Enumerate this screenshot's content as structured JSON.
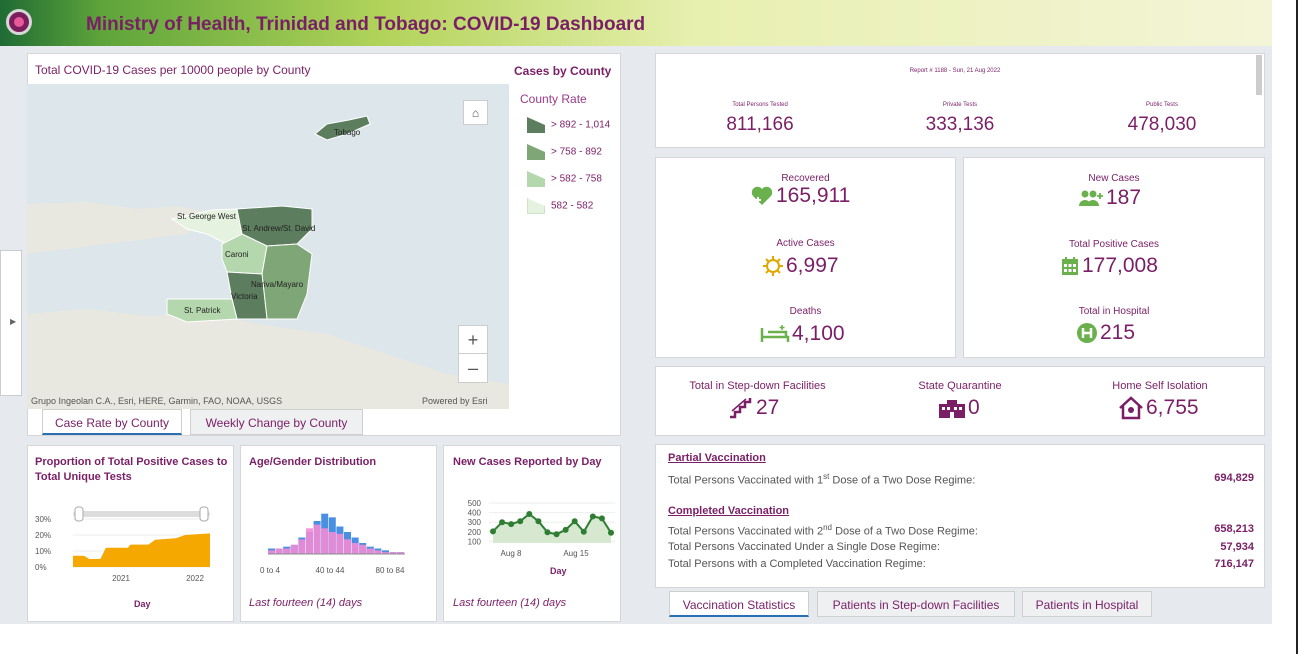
{
  "header": {
    "title": "Ministry of Health, Trinidad and Tobago: COVID-19 Dashboard"
  },
  "map": {
    "title": "Total COVID-19 Cases per 10000 people by County",
    "attribution": "Grupo Ingeolan C.A., Esri, HERE, Garmin, FAO, NOAA, USGS",
    "powered_by": "Powered by Esri",
    "home_icon": "home-icon",
    "zoom_in": "+",
    "zoom_out": "–",
    "counties": [
      "Tobago",
      "St. George West",
      "St. Andrew/St. David",
      "Caroni",
      "Nariva/Mayaro",
      "Victoria",
      "St. Patrick"
    ],
    "legend": {
      "title": "Cases by County",
      "subtitle": "County Rate",
      "items": [
        {
          "label": "> 892 - 1,014",
          "color": "#5c7d5e"
        },
        {
          "label": "> 758 - 892",
          "color": "#7fa677"
        },
        {
          "label": "> 582 - 758",
          "color": "#b5d7ad"
        },
        {
          "label": "582 - 582",
          "color": "#e6f2e0"
        }
      ]
    },
    "tabs": [
      "Case Rate by County",
      "Weekly Change by County"
    ]
  },
  "report": {
    "number": "Report # 1188 - Sun, 21 Aug 2022",
    "tests": [
      {
        "label": "Total Persons Tested",
        "value": "811,166"
      },
      {
        "label": "Private Tests",
        "value": "333,136"
      },
      {
        "label": "Public Tests",
        "value": "478,030"
      }
    ]
  },
  "kpis_left": [
    {
      "label": "Recovered",
      "value": "165,911",
      "icon": "heart-plus-icon",
      "color": "#6ab04c"
    },
    {
      "label": "Active Cases",
      "value": "6,997",
      "icon": "virus-icon",
      "color": "#e0a800"
    },
    {
      "label": "Deaths",
      "value": "4,100",
      "icon": "bed-icon",
      "color": "#6ab04c"
    }
  ],
  "kpis_right": [
    {
      "label": "New Cases",
      "value": "187",
      "icon": "people-plus-icon",
      "color": "#6ab04c"
    },
    {
      "label": "Total Positive Cases",
      "value": "177,008",
      "icon": "calendar-icon",
      "color": "#6ab04c"
    },
    {
      "label": "Total in Hospital",
      "value": "215",
      "icon": "hospital-icon",
      "color": "#6ab04c"
    }
  ],
  "facilities": [
    {
      "label": "Total in Step-down Facilities",
      "value": "27",
      "icon": "stairs-icon"
    },
    {
      "label": "State Quarantine",
      "value": "0",
      "icon": "building-icon"
    },
    {
      "label": "Home Self Isolation",
      "value": "6,755",
      "icon": "house-icon"
    }
  ],
  "vaccination": {
    "partial_heading": "Partial Vaccination",
    "partial_rows": [
      {
        "pre": "Total Persons Vaccinated with 1",
        "sup": "st",
        "post": " Dose of a Two Dose Regime:",
        "value": "694,829"
      }
    ],
    "completed_heading": "Completed Vaccination",
    "completed_rows": [
      {
        "pre": "Total Persons Vaccinated with 2",
        "sup": "nd",
        "post": " Dose of a Two Dose Regime:",
        "value": "658,213"
      },
      {
        "pre": "Total Persons Vaccinated Under a Single Dose Regime:",
        "sup": "",
        "post": "",
        "value": "57,934"
      },
      {
        "pre": "Total Persons with a Completed Vaccination Regime:",
        "sup": "",
        "post": "",
        "value": "716,147"
      }
    ],
    "tabs": [
      "Vaccination Statistics",
      "Patients in Step-down Facilities",
      "Patients in Hospital"
    ]
  },
  "cards": {
    "proportion": {
      "title": "Proportion of Total Positive Cases to Total Unique Tests",
      "xtitle": "Day"
    },
    "age": {
      "title": "Age/Gender Distribution",
      "note": "Last fourteen (14) days"
    },
    "newcases": {
      "title": "New Cases Reported by Day",
      "xtitle": "Day",
      "note": "Last fourteen (14) days"
    }
  },
  "chart_data": [
    {
      "type": "area",
      "title": "Proportion of Total Positive Cases to Total Unique Tests",
      "xlabel": "Day",
      "ylabel": "",
      "x_tick_labels": [
        "2021",
        "2022"
      ],
      "y_tick_labels": [
        "30%",
        "20%",
        "10%",
        "0%"
      ],
      "ylim": [
        0,
        0.3
      ],
      "color": "#f5a800",
      "points": [
        [
          0,
          0.07
        ],
        [
          0.08,
          0.07
        ],
        [
          0.12,
          0.05
        ],
        [
          0.2,
          0.05
        ],
        [
          0.24,
          0.12
        ],
        [
          0.4,
          0.12
        ],
        [
          0.42,
          0.14
        ],
        [
          0.55,
          0.14
        ],
        [
          0.6,
          0.17
        ],
        [
          0.75,
          0.18
        ],
        [
          0.82,
          0.2
        ],
        [
          1,
          0.21
        ]
      ]
    },
    {
      "type": "bar",
      "title": "Age/Gender Distribution",
      "x_tick_labels": [
        "0 to 4",
        "40 to 44",
        "80 to 84"
      ],
      "series": [
        {
          "name": "",
          "color": "#4a90e2",
          "values": [
            3,
            3,
            4,
            5,
            9,
            12,
            18,
            22,
            20,
            15,
            12,
            9,
            6,
            4,
            3,
            2,
            1,
            1
          ]
        },
        {
          "name": "",
          "color": "#f28bd6",
          "values": [
            2,
            3,
            3,
            5,
            8,
            14,
            16,
            14,
            12,
            11,
            8,
            6,
            5,
            3,
            2,
            1,
            1,
            1
          ]
        }
      ]
    },
    {
      "type": "line",
      "title": "New Cases Reported by Day",
      "xlabel": "Day",
      "x_tick_labels": [
        "Aug 8",
        "Aug 15"
      ],
      "y_tick_labels": [
        "500",
        "400",
        "300",
        "200",
        "100"
      ],
      "ylim": [
        0,
        500
      ],
      "color": "#2f7d32",
      "values": [
        205,
        300,
        280,
        310,
        385,
        310,
        195,
        175,
        220,
        310,
        200,
        360,
        340,
        190
      ]
    }
  ]
}
